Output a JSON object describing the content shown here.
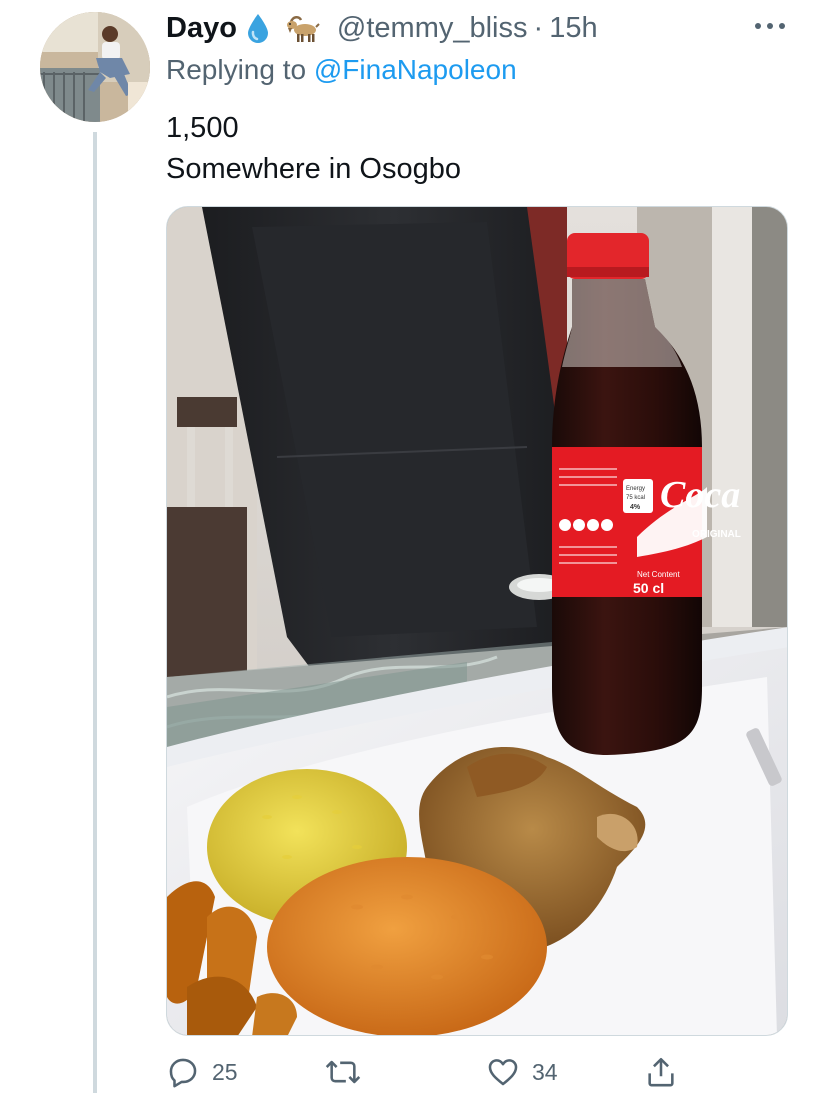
{
  "tweet": {
    "author": {
      "display_name": "Dayo",
      "handle": "@temmy_bliss",
      "badges": [
        "droplet-emoji",
        "goat-emoji"
      ]
    },
    "separator": "·",
    "time": "15h",
    "reply_prefix": "Replying to",
    "reply_to": "@FinaNapoleon",
    "text_lines": [
      "1,500",
      "Somewhere in Osogbo"
    ],
    "media": {
      "description_icons": [
        "coke-bottle",
        "plate",
        "yellow-rice",
        "jollof-rice",
        "chicken",
        "plantain"
      ],
      "bottle_label": {
        "brand": "Coca",
        "sub": "ORIGINAL",
        "volume": "50 cl",
        "net": "Net Content",
        "energy": "Energy",
        "kcal": "75 kcal",
        "pct": "4%"
      }
    },
    "actions": {
      "reply_count": "25",
      "retweet_count": "",
      "like_count": "34"
    }
  },
  "colors": {
    "text_primary": "#0f1419",
    "text_secondary": "#536471",
    "link": "#1d9bf0",
    "thread_line": "#cfd9de",
    "coke_red": "#e41b23"
  }
}
